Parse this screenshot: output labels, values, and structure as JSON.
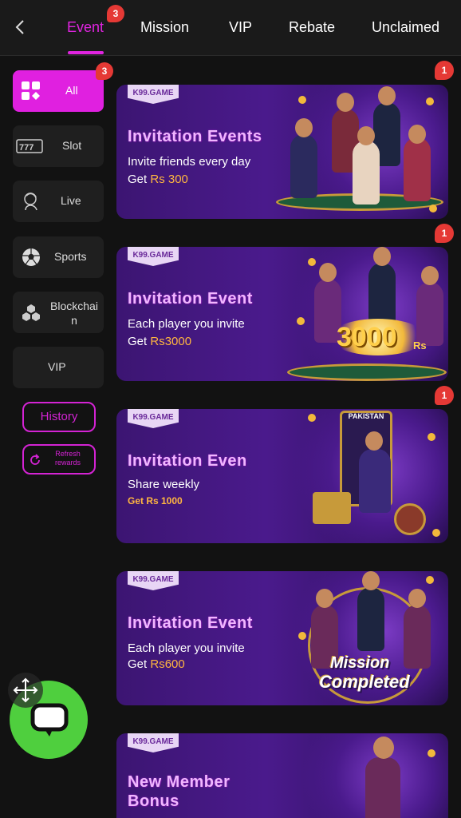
{
  "header": {
    "tabs": [
      {
        "label": "Event",
        "badge": "3"
      },
      {
        "label": "Mission"
      },
      {
        "label": "VIP"
      },
      {
        "label": "Rebate"
      },
      {
        "label": "Unclaimed"
      }
    ]
  },
  "sidebar": {
    "items": [
      {
        "label": "All",
        "badge": "3"
      },
      {
        "label": "Slot"
      },
      {
        "label": "Live"
      },
      {
        "label": "Sports"
      },
      {
        "label": "Blockchai\nn"
      },
      {
        "label": "VIP"
      }
    ],
    "history_label": "History",
    "refresh_label_1": "Refresh",
    "refresh_label_2": "rewards"
  },
  "cards": [
    {
      "brand": "K99.GAME",
      "title": "Invitation Events",
      "desc": "Invite friends every day",
      "sub_prefix": "Get ",
      "sub_amount": "Rs 300",
      "badge": "1"
    },
    {
      "brand": "K99.GAME",
      "title": "Invitation Event",
      "desc": "Each player you invite",
      "sub_prefix": "Get ",
      "sub_amount": "Rs3000",
      "badge": "1",
      "art_text": "3000",
      "art_unit": "Rs"
    },
    {
      "brand": "K99.GAME",
      "title": "Invitation Even",
      "desc": "Share weekly",
      "sub_prefix": "",
      "sub_amount": "Get Rs 1000",
      "badge": "1",
      "art_text": "PAKISTAN"
    },
    {
      "brand": "K99.GAME",
      "title": "Invitation Event",
      "desc": "Each player you invite",
      "sub_prefix": "Get ",
      "sub_amount": "Rs600",
      "art_text_1": "Mission",
      "art_text_2": "Completed"
    },
    {
      "brand": "K99.GAME",
      "title_1": "New Member",
      "title_2": "Bonus"
    }
  ],
  "colors": {
    "accent": "#e020e0",
    "badge": "#e53935",
    "amount": "#ffb640",
    "chat": "#4fcf3e"
  },
  "icons": [
    "back-arrow-icon",
    "grid-icon",
    "slot-777-icon",
    "live-dealer-icon",
    "soccer-ball-icon",
    "blockchain-cubes-icon",
    "refresh-icon",
    "move-arrows-icon",
    "chat-bubble-icon"
  ]
}
